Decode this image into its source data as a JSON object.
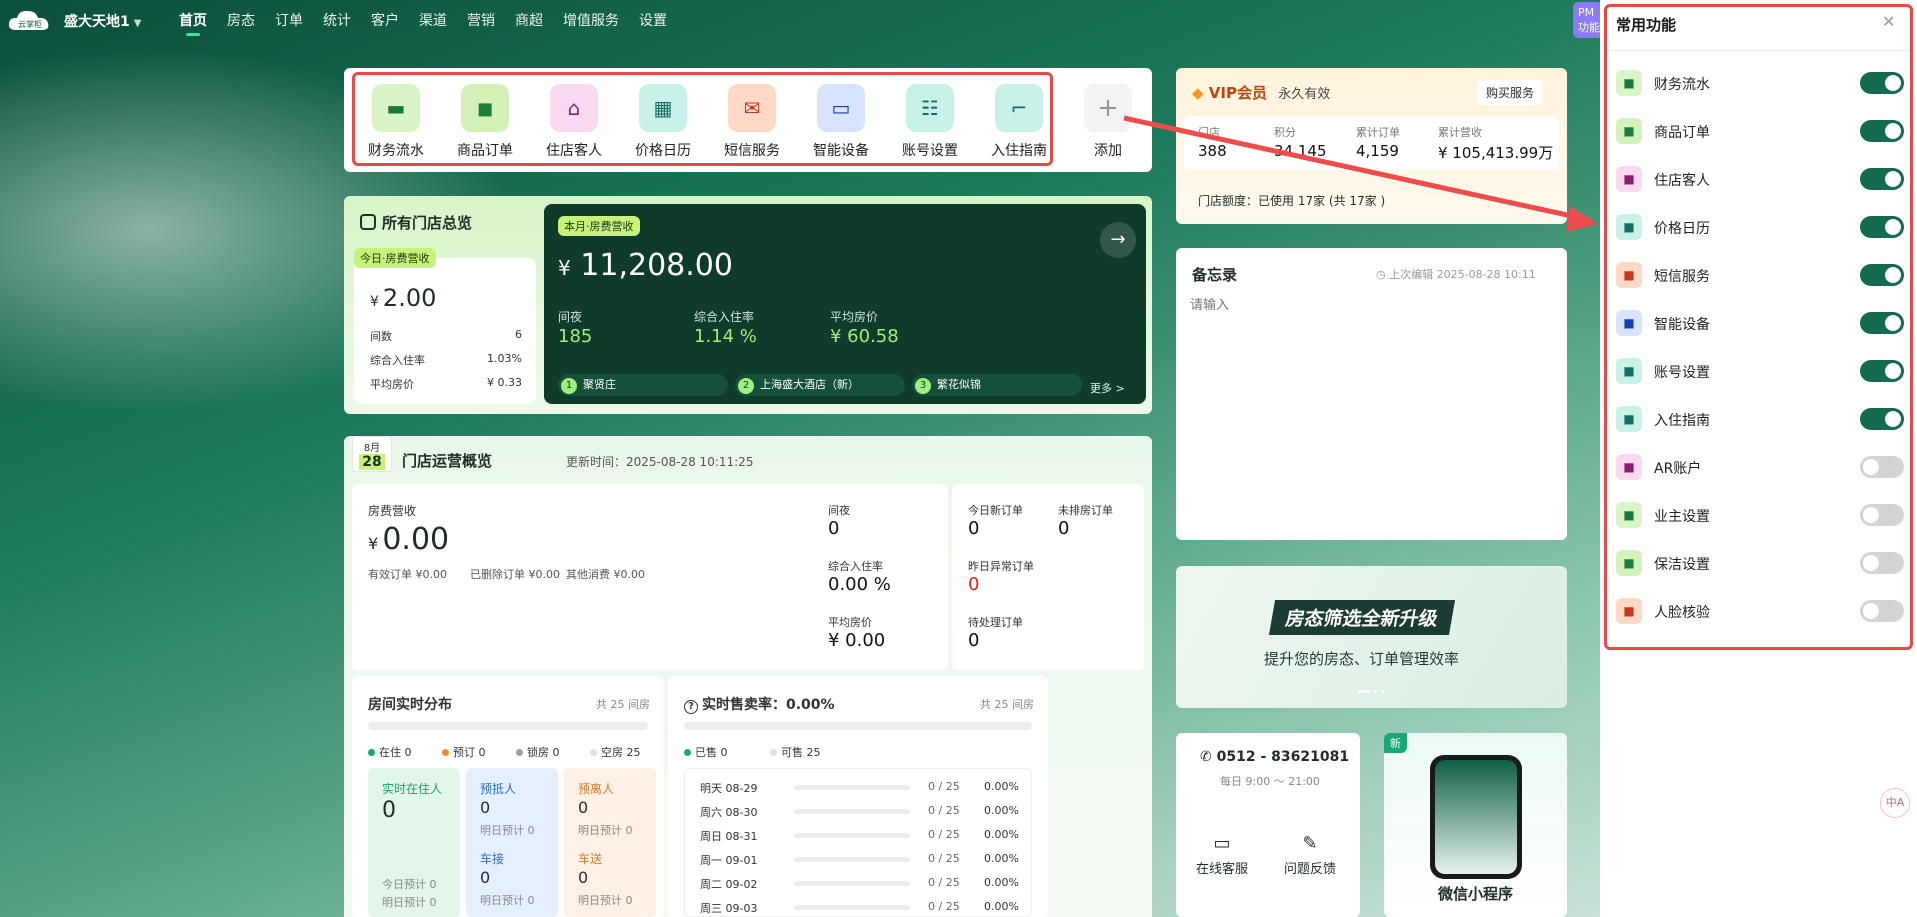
{
  "nav": {
    "logo": "云掌柜",
    "store": "盛大天地1",
    "items": [
      "首页",
      "房态",
      "订单",
      "统计",
      "客户",
      "渠道",
      "营销",
      "商超",
      "增值服务",
      "设置"
    ],
    "pm": "PM 功能"
  },
  "quick": {
    "items": [
      {
        "label": "财务流水",
        "color": "#d9f5c5",
        "glyph": "▬",
        "fg": "#1a7a3a"
      },
      {
        "label": "商品订单",
        "color": "#d4f2b8",
        "glyph": "◼",
        "fg": "#1d7d3d"
      },
      {
        "label": "住店客人",
        "color": "#f9d9f0",
        "glyph": "⌂",
        "fg": "#8c1c70"
      },
      {
        "label": "价格日历",
        "color": "#c8f1ea",
        "glyph": "▦",
        "fg": "#127063"
      },
      {
        "label": "短信服务",
        "color": "#ffd8c7",
        "glyph": "✉",
        "fg": "#c23a1a"
      },
      {
        "label": "智能设备",
        "color": "#d7e3ff",
        "glyph": "▭",
        "fg": "#1740b3"
      },
      {
        "label": "账号设置",
        "color": "#c8f1ea",
        "glyph": "☷",
        "fg": "#127063"
      },
      {
        "label": "入住指南",
        "color": "#c8f1ea",
        "glyph": "⌐",
        "fg": "#127063"
      }
    ],
    "add_label": "添加",
    "add_glyph": "+"
  },
  "overview": {
    "title": "所有门店总览",
    "today_tag": "今日·房费营收",
    "today_value": "2.00",
    "currency": "¥",
    "rows": [
      {
        "k": "间数",
        "v": "6"
      },
      {
        "k": "综合入住率",
        "v": "1.03%"
      },
      {
        "k": "平均房价",
        "v": "¥ 0.33"
      }
    ],
    "month_tag": "本月·房费营收",
    "month_value": "11,208.00",
    "stats": [
      {
        "k": "间夜",
        "v": "185"
      },
      {
        "k": "综合入住率",
        "v": "1.14 %"
      },
      {
        "k": "平均房价",
        "v": "¥ 60.58"
      }
    ],
    "ranks": [
      "聚贤庄",
      "上海盛大酒店（新）",
      "繁花似锦"
    ],
    "more": "更多 >",
    "arrow": "→"
  },
  "ops": {
    "month": "8月",
    "day": "28",
    "title": "门店运营概览",
    "updated": "更新时间：2025-08-28 10:11:25",
    "revenue_label": "房费营收",
    "revenue": "0.00",
    "breakdown": [
      "有效订单 ¥0.00",
      "已删除订单 ¥0.00",
      "其他消费 ¥0.00"
    ],
    "mid": [
      {
        "k": "间夜",
        "v": "0"
      },
      {
        "k": "综合入住率",
        "v": "0.00 %"
      },
      {
        "k": "平均房价",
        "v": "¥ 0.00"
      }
    ],
    "right": [
      {
        "k": "今日新订单",
        "v": "0"
      },
      {
        "k": "未排房订单",
        "v": "0"
      },
      {
        "k": "昨日异常订单",
        "v": "0"
      },
      {
        "k": "待处理订单",
        "v": "0"
      }
    ],
    "dist": {
      "title": "房间实时分布",
      "total": "共 25 间房",
      "legend": [
        {
          "k": "在住 0",
          "c": "#17a876"
        },
        {
          "k": "预订 0",
          "c": "#f08a2c"
        },
        {
          "k": "锁房 0",
          "c": "#9e9e9e"
        },
        {
          "k": "空房 25",
          "c": "#e0e0e0"
        }
      ],
      "boxes": [
        {
          "t": "实时在住人",
          "v": "0",
          "s": "今日预计 0",
          "s2": "明日预计 0",
          "tc": "#1d9d6a",
          "bg": "#e3f6ea"
        },
        {
          "t": "预抵人",
          "v": "0",
          "s": "明日预计 0",
          "t2": "车接",
          "v2": "0",
          "s3": "明日预计 0",
          "tc": "#2a6ad1",
          "bg": "#e6efff"
        },
        {
          "t": "预离人",
          "v": "0",
          "s": "明日预计 0",
          "t2": "车送",
          "v2": "0",
          "s3": "明日预计 0",
          "tc": "#e2752a",
          "bg": "#fff1e6"
        }
      ]
    },
    "sales": {
      "title": "实时售卖率：0.00%",
      "total": "共 25 间房",
      "legend": [
        {
          "k": "已售 0",
          "c": "#17a876"
        },
        {
          "k": "可售 25",
          "c": "#e0e0e0"
        }
      ],
      "rows": [
        {
          "d": "明天 08-29",
          "n": "0 / 25",
          "p": "0.00%"
        },
        {
          "d": "周六 08-30",
          "n": "0 / 25",
          "p": "0.00%"
        },
        {
          "d": "周日 08-31",
          "n": "0 / 25",
          "p": "0.00%"
        },
        {
          "d": "周一 09-01",
          "n": "0 / 25",
          "p": "0.00%"
        },
        {
          "d": "周二 09-02",
          "n": "0 / 25",
          "p": "0.00%"
        },
        {
          "d": "周三 09-03",
          "n": "0 / 25",
          "p": "0.00%"
        }
      ]
    }
  },
  "vip": {
    "title": "VIP会员",
    "period": "永久有效",
    "buy": "购买服务",
    "stats": [
      {
        "k": "门店",
        "v": "388"
      },
      {
        "k": "积分",
        "v": "34,145"
      },
      {
        "k": "累计订单",
        "v": "4,159"
      },
      {
        "k": "累计营收",
        "v": "¥ 105,413.99万"
      }
    ],
    "quota": "门店额度：已使用 17家 (共 17家 )"
  },
  "memo": {
    "title": "备忘录",
    "edited": "上次编辑 2025-08-28 10:11",
    "placeholder": "请输入"
  },
  "banner": {
    "headline": "房态筛选全新升级",
    "sub": "提升您的房态、订单管理效率"
  },
  "service": {
    "phone": "0512 - 83621081",
    "hours": "每日 9:00 ～ 21:00",
    "online": "在线客服",
    "feedback": "问题反馈"
  },
  "mini": {
    "badge": "新",
    "label": "微信小程序"
  },
  "panel": {
    "title": "常用功能",
    "items": [
      {
        "label": "财务流水",
        "on": true,
        "c": "#d9f5c5",
        "f": "#1a7a3a"
      },
      {
        "label": "商品订单",
        "on": true,
        "c": "#d4f2b8",
        "f": "#1d7d3d"
      },
      {
        "label": "住店客人",
        "on": true,
        "c": "#f9d9f0",
        "f": "#8c1c70"
      },
      {
        "label": "价格日历",
        "on": true,
        "c": "#c8f1ea",
        "f": "#127063"
      },
      {
        "label": "短信服务",
        "on": true,
        "c": "#ffd8c7",
        "f": "#c23a1a"
      },
      {
        "label": "智能设备",
        "on": true,
        "c": "#d7e3ff",
        "f": "#1740b3"
      },
      {
        "label": "账号设置",
        "on": true,
        "c": "#c8f1ea",
        "f": "#127063"
      },
      {
        "label": "入住指南",
        "on": true,
        "c": "#c8f1ea",
        "f": "#127063"
      },
      {
        "label": "AR账户",
        "on": false,
        "c": "#f9d9f0",
        "f": "#8c1c70"
      },
      {
        "label": "业主设置",
        "on": false,
        "c": "#d9f5c5",
        "f": "#1a7a3a"
      },
      {
        "label": "保洁设置",
        "on": false,
        "c": "#d4f2b8",
        "f": "#1d7d3d"
      },
      {
        "label": "人脸核验",
        "on": false,
        "c": "#ffd8c7",
        "f": "#c23a1a"
      }
    ]
  }
}
